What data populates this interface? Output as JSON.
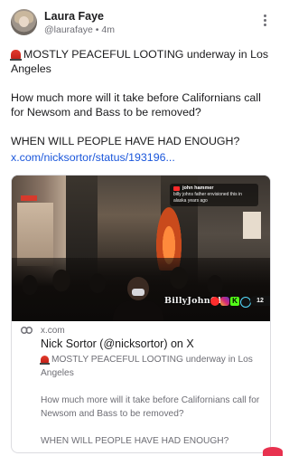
{
  "author": {
    "name": "Laura Faye",
    "handle": "@laurafaye",
    "separator": "•",
    "time": "4m"
  },
  "post": {
    "paragraphs": [
      "MOSTLY PEACEFUL LOOTING underway in Los Angeles",
      "How much more will it take before Californians call for Newsom and Bass to be removed?",
      "WHEN WILL PEOPLE HAVE HAD ENOUGH?"
    ],
    "link": "x.com/nicksortor/status/193196..."
  },
  "video": {
    "overlay_user": "john hammer",
    "overlay_text_1": "billy johns father envisioned this in",
    "overlay_text_2": "alaska years ago",
    "watermark": "BillyJohnOh",
    "badge": "12"
  },
  "card": {
    "domain": "x.com",
    "title": "Nick Sortor (@nicksortor) on X",
    "desc_paragraphs": [
      "MOSTLY PEACEFUL LOOTING underway in Los Angeles",
      "How much more will it take before Californians call for Newsom and Bass to be removed?",
      "WHEN WILL PEOPLE HAVE HAD ENOUGH?"
    ]
  },
  "icons": {
    "menu": "kebab-icon",
    "siren": "police-light-icon",
    "link": "link-icon"
  },
  "colors": {
    "link": "#1a56db",
    "text": "#1b1b1d",
    "muted": "#6e6e75",
    "border": "#dcdce0"
  }
}
